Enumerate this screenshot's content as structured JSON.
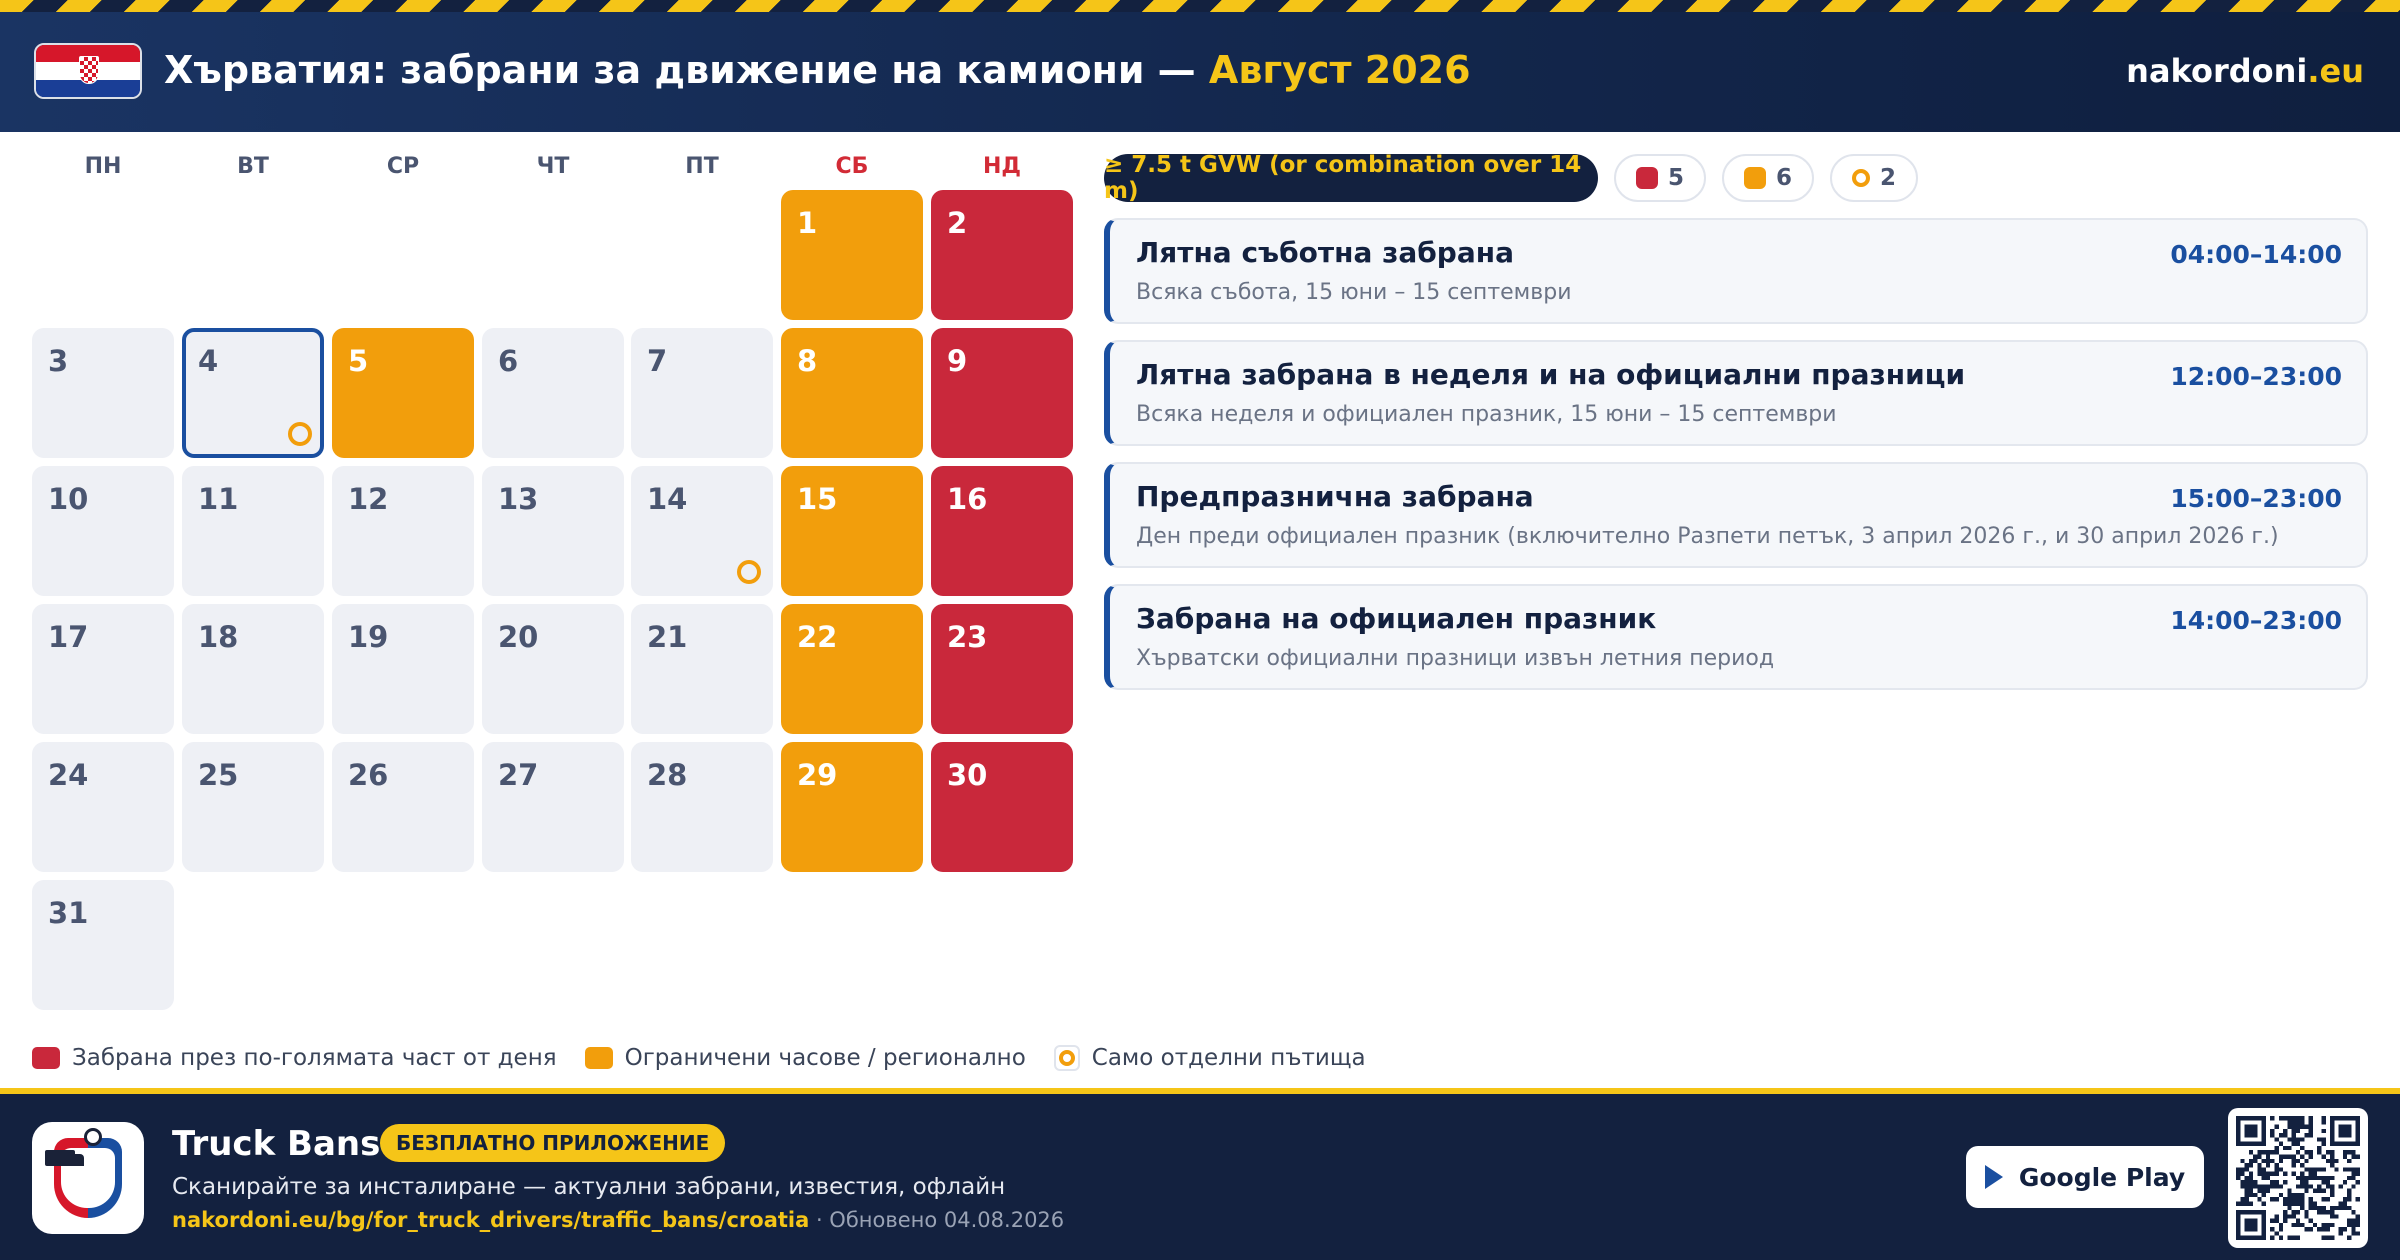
{
  "header": {
    "title_prefix": "Хърватия: забрани за движение на камиони — ",
    "title_month": "Август 2026",
    "brand_name": "nakordoni",
    "brand_tld": ".eu",
    "flag_icon": "croatia-flag-icon"
  },
  "calendar": {
    "weekdays": [
      "ПН",
      "ВТ",
      "СР",
      "ЧТ",
      "ПТ",
      "СБ",
      "НД"
    ],
    "days": [
      {
        "n": "1",
        "type": "sat"
      },
      {
        "n": "2",
        "type": "sun"
      },
      {
        "n": "3",
        "type": "normal"
      },
      {
        "n": "4",
        "type": "today",
        "ring": true
      },
      {
        "n": "5",
        "type": "sat"
      },
      {
        "n": "6",
        "type": "normal"
      },
      {
        "n": "7",
        "type": "normal"
      },
      {
        "n": "8",
        "type": "sat"
      },
      {
        "n": "9",
        "type": "sun"
      },
      {
        "n": "10",
        "type": "normal"
      },
      {
        "n": "11",
        "type": "normal"
      },
      {
        "n": "12",
        "type": "normal"
      },
      {
        "n": "13",
        "type": "normal"
      },
      {
        "n": "14",
        "type": "normal",
        "ring": true
      },
      {
        "n": "15",
        "type": "sat"
      },
      {
        "n": "16",
        "type": "sun"
      },
      {
        "n": "17",
        "type": "normal"
      },
      {
        "n": "18",
        "type": "normal"
      },
      {
        "n": "19",
        "type": "normal"
      },
      {
        "n": "20",
        "type": "normal"
      },
      {
        "n": "21",
        "type": "normal"
      },
      {
        "n": "22",
        "type": "sat"
      },
      {
        "n": "23",
        "type": "sun"
      },
      {
        "n": "24",
        "type": "normal"
      },
      {
        "n": "25",
        "type": "normal"
      },
      {
        "n": "26",
        "type": "normal"
      },
      {
        "n": "27",
        "type": "normal"
      },
      {
        "n": "28",
        "type": "normal"
      },
      {
        "n": "29",
        "type": "sat"
      },
      {
        "n": "30",
        "type": "sun"
      },
      {
        "n": "31",
        "type": "normal"
      }
    ],
    "first_weekday_index": 5
  },
  "filters": {
    "vehicle_label": "≥ 7.5 t GVW (or combination over 14 m)",
    "red_count": "5",
    "orange_count": "6",
    "ring_count": "2"
  },
  "rules": [
    {
      "title": "Лятна съботна забрана",
      "time": "04:00–14:00",
      "desc": "Всяка събота, 15 юни – 15 септември"
    },
    {
      "title": "Лятна забрана в неделя и на официални празници",
      "time": "12:00–23:00",
      "desc": "Всяка неделя и официален празник, 15 юни – 15 септември"
    },
    {
      "title": "Предпразнична забрана",
      "time": "15:00–23:00",
      "desc": "Ден преди официален празник (включително Разпети петък, 3 април 2026 г., и 30 април 2026 г.)"
    },
    {
      "title": "Забрана на официален празник",
      "time": "14:00–23:00",
      "desc": "Хърватски официални празници извън летния период"
    }
  ],
  "legend": {
    "red": "Забрана през по-голямата част от деня",
    "orange": "Ограничени часове / регионално",
    "ring": "Само отделни пътища"
  },
  "footer": {
    "app_name": "Truck Bans",
    "badge": "БЕЗПЛАТНО ПРИЛОЖЕНИЕ",
    "tagline": "Сканирайте за инсталиране — актуални забрани, известия, офлайн",
    "url": "nakordoni.eu/bg/for_truck_drivers/traffic_bans/croatia",
    "updated": " · Обновено 04.08.2026",
    "store_label": "Google Play",
    "app_icon": "truck-bans-app-icon",
    "qr_icon": "qr-code-icon"
  },
  "colors": {
    "header_bg": "#13274d",
    "accent_yellow": "#f5c518",
    "ban_red": "#c9283b",
    "limited_orange": "#f29e0c",
    "today_blue": "#1a4fa0"
  }
}
